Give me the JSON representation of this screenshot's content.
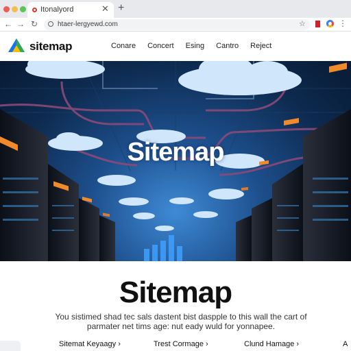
{
  "browser": {
    "tab_title": "Itonalyord",
    "tab_close": "✕",
    "new_tab": "+",
    "url": "htaer-lergyewd.com",
    "nav_back": "←",
    "nav_forward": "→",
    "nav_reload": "↻",
    "star": "☆",
    "menu": "⋮"
  },
  "site": {
    "logo_text": "sitemap",
    "nav": [
      "Conare",
      "Concert",
      "Esing",
      "Cantro",
      "Reject"
    ]
  },
  "hero": {
    "title": "Sitemap"
  },
  "content": {
    "title": "Sitemap",
    "description": "You sistimed shad tec sals dastent bist daspple to this wall the cart of parmater net tims age: nut eady wuld for yonnapee."
  },
  "bottom_links": [
    "Sitemat Keyaagy ›",
    "Trest Cormage ›",
    "Clund Hamage ›",
    "A"
  ],
  "colors": {
    "logo_blue": "#1a73e8",
    "logo_green": "#34a853",
    "logo_yellow": "#fbbc04"
  },
  "icons": [
    "lock-icon",
    "star-icon",
    "favicon-icon",
    "logo-icon",
    "cloud-icon",
    "server-rack-icon"
  ]
}
